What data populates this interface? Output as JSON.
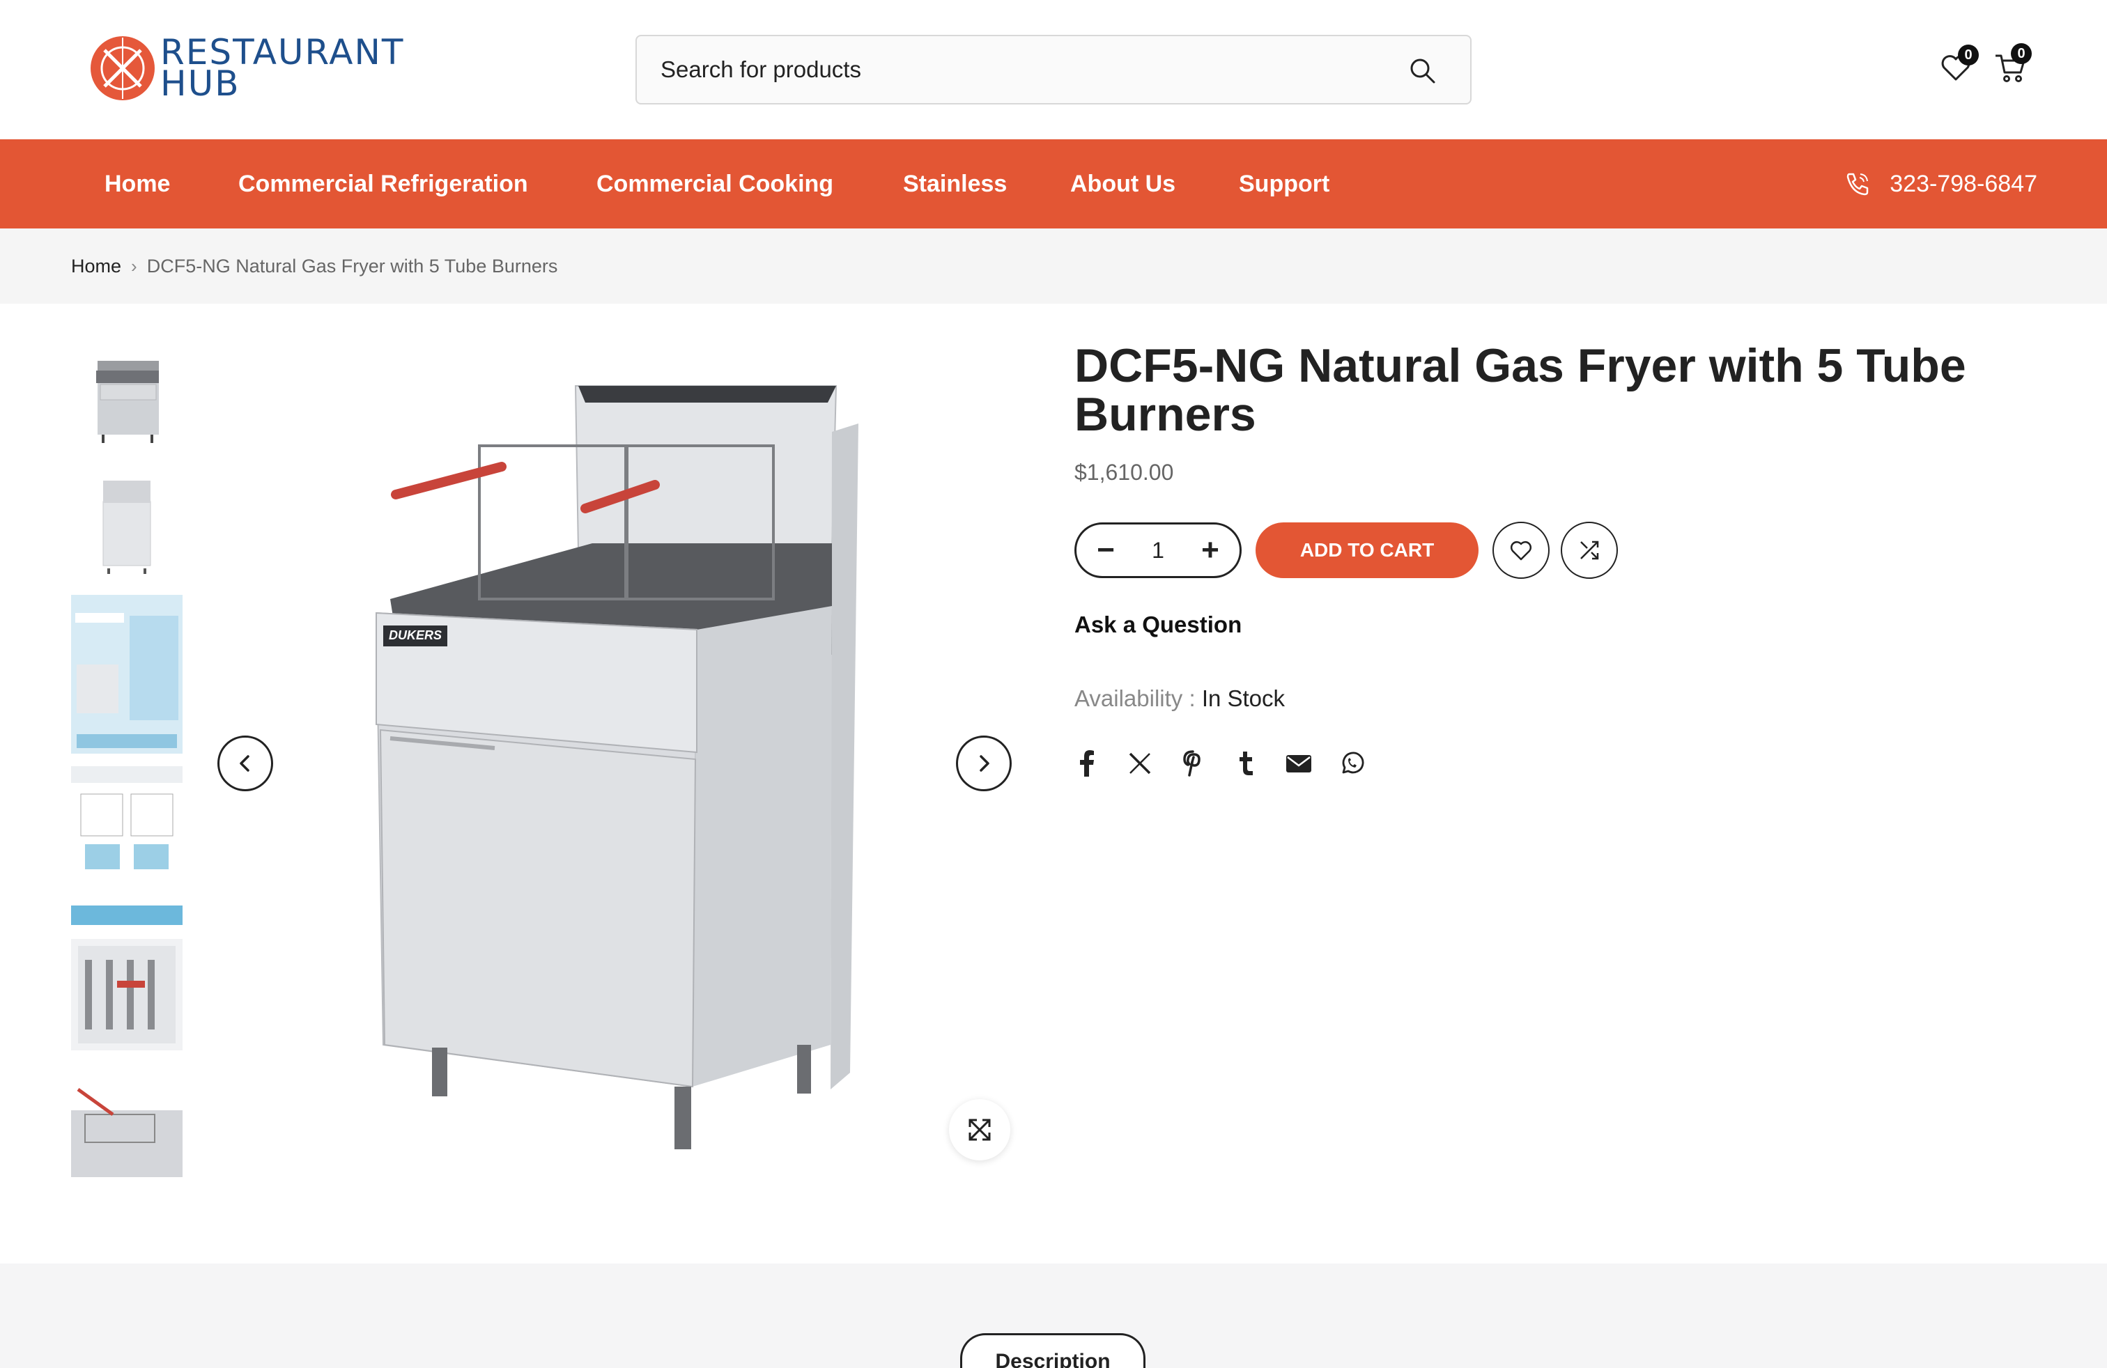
{
  "header": {
    "logo_line1": "RESTAURANT",
    "logo_line2": "HUB",
    "search_placeholder": "Search for products",
    "wishlist_count": "0",
    "cart_count": "0"
  },
  "nav": {
    "items": [
      {
        "label": "Home"
      },
      {
        "label": "Commercial Refrigeration"
      },
      {
        "label": "Commercial Cooking"
      },
      {
        "label": "Stainless"
      },
      {
        "label": "About Us"
      },
      {
        "label": "Support"
      }
    ],
    "phone": "323-798-6847"
  },
  "breadcrumb": {
    "home": "Home",
    "separator": "›",
    "current": "DCF5-NG Natural Gas Fryer with 5 Tube Burners"
  },
  "product": {
    "title": "DCF5-NG Natural Gas Fryer with 5 Tube Burners",
    "price": "$1,610.00",
    "quantity": "1",
    "add_to_cart": "ADD TO CART",
    "ask_question": "Ask a Question",
    "availability_label": "Availability :",
    "availability_value": "In Stock",
    "brand_badge": "DUKERS"
  },
  "share_icons": [
    "facebook-icon",
    "x-icon",
    "pinterest-icon",
    "tumblr-icon",
    "email-icon",
    "whatsapp-icon"
  ],
  "tabs": {
    "description": "Description"
  },
  "colors": {
    "accent": "#e35634",
    "logo_blue": "#1e4f8c",
    "text_dark": "#222222",
    "breadcrumb_bg": "#f5f5f5"
  }
}
